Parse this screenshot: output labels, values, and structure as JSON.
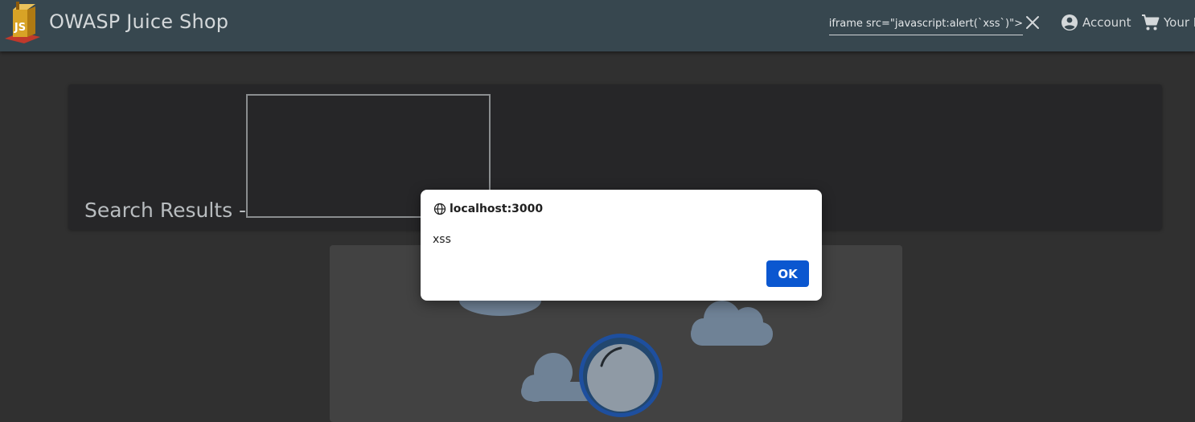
{
  "header": {
    "app_title": "OWASP Juice Shop",
    "logo_text": "JS",
    "search": {
      "value": "iframe src=\"javascript:alert(`xss`)\">"
    },
    "account_label": "Account",
    "basket_label": "Your Basket"
  },
  "results": {
    "heading": "Search Results -"
  },
  "alert": {
    "origin": "localhost:3000",
    "message": "xss",
    "ok_label": "OK"
  },
  "colors": {
    "toolbar": "#37474f",
    "page_background": "#303030",
    "card": "#262628",
    "cloud": "#6f8296",
    "dialog_button": "#0b57d0"
  }
}
